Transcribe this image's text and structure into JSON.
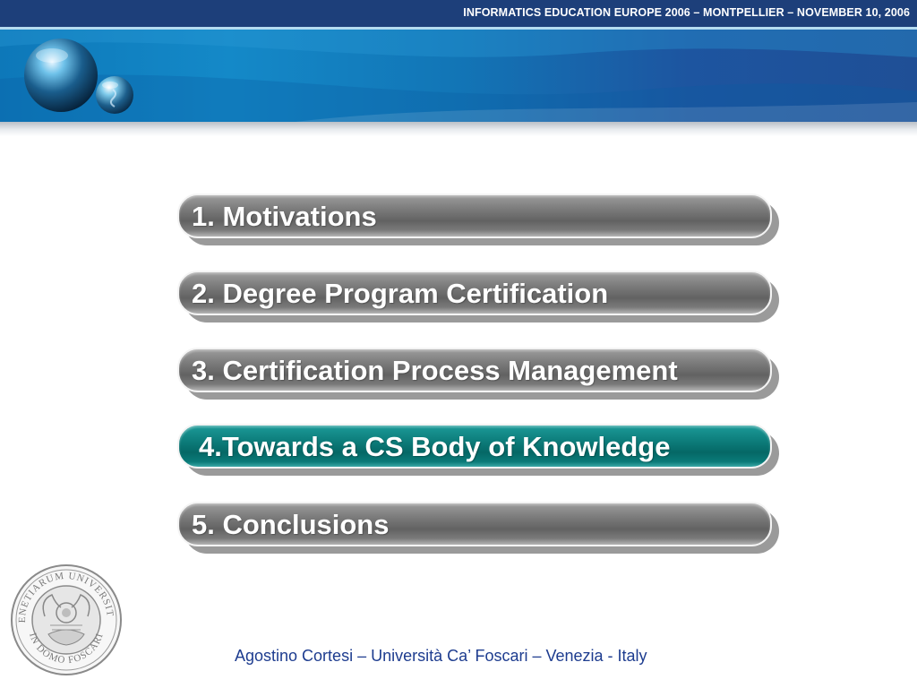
{
  "header": {
    "conference": "INFORMATICS EDUCATION EUROPE 2006 – MONTPELLIER – NOVEMBER 10, 2006"
  },
  "menu": {
    "items": [
      {
        "label": "1. Motivations",
        "active": false
      },
      {
        "label": "2. Degree Program Certification",
        "active": false
      },
      {
        "label": "3. Certification Process Management",
        "active": false
      },
      {
        "label": "4.Towards a CS Body of Knowledge",
        "active": true
      },
      {
        "label": "5. Conclusions",
        "active": false
      }
    ]
  },
  "seal": {
    "lettering": "UNIVERSITAS VENETIARUM IN DOMO FOSCARI",
    "icon": "university-seal-icon"
  },
  "logo": {
    "icon": "globe-orbs-logo-icon"
  },
  "footer": {
    "author": "Agostino Cortesi – Università Ca’ Foscari – Venezia - Italy"
  },
  "colors": {
    "header_bar": "#1d3f7a",
    "banner_light": "#1489c8",
    "banner_dark": "#1f4f96",
    "pill_gray": "#7e7e7e",
    "pill_active_teal": "#0e7f7d",
    "footer_text": "#1d3c8f"
  }
}
